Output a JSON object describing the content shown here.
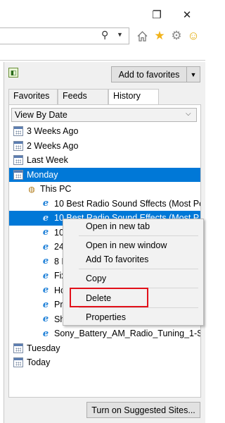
{
  "window": {
    "restore_glyph": "❐",
    "close_glyph": "✕"
  },
  "toolbar": {
    "search_glyph": "⚲",
    "icons": [
      "home-icon",
      "favorites-star-icon",
      "settings-gear-icon",
      "smiley-feedback-icon"
    ]
  },
  "panel": {
    "add_to_favorites": "Add to favorites",
    "tabs": [
      "Favorites",
      "Feeds",
      "History"
    ],
    "active_tab": "History",
    "view_by": "View By Date",
    "history": [
      {
        "label": "3 Weeks Ago",
        "kind": "date"
      },
      {
        "label": "2 Weeks Ago",
        "kind": "date"
      },
      {
        "label": "Last Week",
        "kind": "date"
      },
      {
        "label": "Monday",
        "kind": "date",
        "selected": true
      },
      {
        "label": "This PC",
        "kind": "pc"
      },
      {
        "label": "10 Best Radio Sound Sffects (Most Po...",
        "kind": "page"
      },
      {
        "label": "10 Best Radio Sound Effects (Most P...",
        "kind": "page",
        "selected": true
      },
      {
        "label": "10",
        "kind": "page"
      },
      {
        "label": "24",
        "kind": "page"
      },
      {
        "label": "8 I",
        "kind": "page"
      },
      {
        "label": "Fix",
        "kind": "page"
      },
      {
        "label": "Ho",
        "kind": "page"
      },
      {
        "label": "Pr",
        "kind": "page"
      },
      {
        "label": "Sh",
        "kind": "page"
      },
      {
        "label": "Sony_Battery_AM_Radio_Tuning_1-S...",
        "kind": "page"
      },
      {
        "label": "Tuesday",
        "kind": "date"
      },
      {
        "label": "Today",
        "kind": "date"
      }
    ],
    "suggested_sites": "Turn on Suggested Sites..."
  },
  "context_menu": {
    "open_new_tab": "Open in new tab",
    "open_new_window": "Open in new window",
    "add_to_favorites": "Add To favorites",
    "copy": "Copy",
    "delete": "Delete",
    "properties": "Properties"
  },
  "colors": {
    "selection": "#0078d7",
    "highlight_box": "#e2101a"
  }
}
